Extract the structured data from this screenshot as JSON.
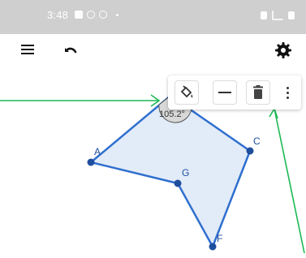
{
  "status_bar": {
    "time": "3:48"
  },
  "toolbar": {
    "menu_icon": "hamburger-menu-icon",
    "undo_icon": "undo-icon",
    "settings_icon": "gear-icon"
  },
  "geometry": {
    "fill_color": "#dde8f7",
    "stroke_color": "#2f6fcf",
    "point_color": "#1f4e9e",
    "label_color": "#1f4e9e",
    "angle_label": "105.2°",
    "points": [
      {
        "label": "A"
      },
      {
        "label": "G"
      },
      {
        "label": "C"
      },
      {
        "label": "F"
      }
    ]
  },
  "style_bar": {
    "fill_icon": "paint-bucket-icon",
    "line_style_icon": "line-style-icon",
    "delete_icon": "trash-icon",
    "more_icon": "more-vertical-icon"
  },
  "annotations": {
    "arrow_color": "#1db954"
  }
}
